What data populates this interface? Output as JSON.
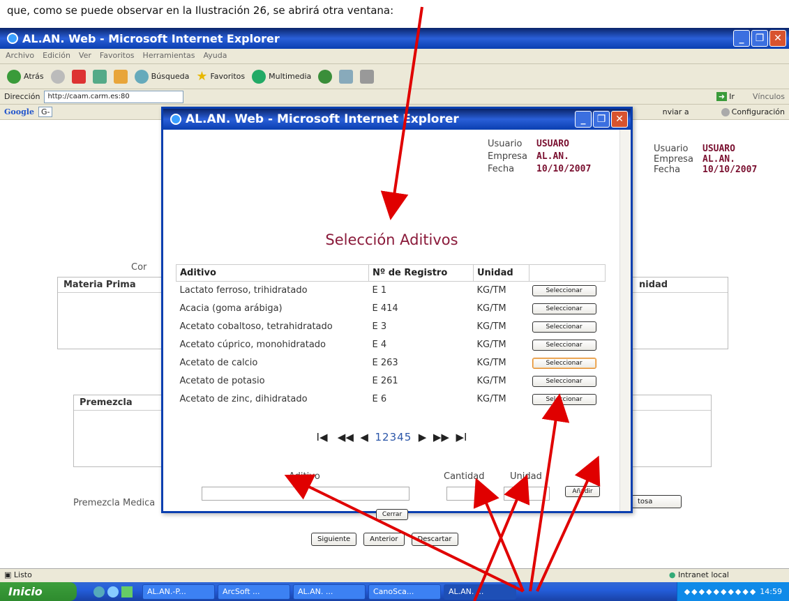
{
  "doc_strip": "que, como se puede observar en la Ilustración 26, se abrirá otra ventana:",
  "main_window": {
    "title": "AL.AN. Web - Microsoft Internet Explorer",
    "menu": [
      "Archivo",
      "Edición",
      "Ver",
      "Favoritos",
      "Herramientas",
      "Ayuda"
    ],
    "toolbar": {
      "back": "Atrás",
      "search": "Búsqueda",
      "favorites": "Favoritos",
      "multimedia": "Multimedia"
    },
    "address_label": "Dirección",
    "address_value": "http://caam.carm.es:80",
    "go_label": "Ir",
    "links_label": "Vínculos",
    "google_label": "Google",
    "google_g": "G-",
    "send_label": "nviar a",
    "config_label": "Configuración"
  },
  "bg_page": {
    "user_label": "Usuario",
    "user_value": "USUARO",
    "company_label": "Empresa",
    "company_value": "AL.AN.",
    "date_label": "Fecha",
    "date_value": "10/10/2007",
    "partial_label": "Cor",
    "materia_prima_header": "Materia Prima",
    "unidad_partial": "nidad",
    "premezcla_header": "Premezcla",
    "premezcla_medica_label": "Premezcla Medica",
    "tosa_button": "tosa",
    "buttons": [
      "Siguiente",
      "Anterior",
      "Descartar"
    ]
  },
  "popup": {
    "title": "AL.AN. Web - Microsoft Internet Explorer",
    "user_label": "Usuario",
    "user_value": "USUARO",
    "company_label": "Empresa",
    "company_value": "AL.AN.",
    "date_label": "Fecha",
    "date_value": "10/10/2007",
    "heading": "Selección Aditivos",
    "columns": [
      "Aditivo",
      "Nº de Registro",
      "Unidad",
      ""
    ],
    "rows": [
      {
        "aditivo": "Lactato ferroso, trihidratado",
        "registro": "E 1",
        "unidad": "KG/TM",
        "button": "Seleccionar"
      },
      {
        "aditivo": "Acacia (goma arábiga)",
        "registro": "E 414",
        "unidad": "KG/TM",
        "button": "Seleccionar"
      },
      {
        "aditivo": "Acetato cobaltoso, tetrahidratado",
        "registro": "E 3",
        "unidad": "KG/TM",
        "button": "Seleccionar"
      },
      {
        "aditivo": "Acetato cúprico, monohidratado",
        "registro": "E 4",
        "unidad": "KG/TM",
        "button": "Seleccionar"
      },
      {
        "aditivo": "Acetato de calcio",
        "registro": "E 263",
        "unidad": "KG/TM",
        "button": "Seleccionar"
      },
      {
        "aditivo": "Acetato de potasio",
        "registro": "E 261",
        "unidad": "KG/TM",
        "button": "Seleccionar"
      },
      {
        "aditivo": "Acetato de zinc, dihidratado",
        "registro": "E 6",
        "unidad": "KG/TM",
        "button": "Seleccionar"
      }
    ],
    "pager": {
      "first": "I◀",
      "prev_block": "◀◀",
      "prev": "◀",
      "pages": "12345",
      "next": "▶",
      "next_block": "▶▶",
      "last": "▶I"
    },
    "form": {
      "aditivo_label": "Aditivo",
      "cantidad_label": "Cantidad",
      "unidad_label": "Unidad",
      "add_button": "Añadir",
      "close_button": "Cerrar"
    }
  },
  "status": {
    "left": "Listo",
    "right": "Intranet local"
  },
  "taskbar": {
    "start": "Inicio",
    "tasks": [
      "AL.AN.-P...",
      "ArcSoft ...",
      "AL.AN. ...",
      "CanoSca...",
      "AL.AN. ..."
    ],
    "clock": "14:59"
  },
  "colors": {
    "accent_red": "#e00000",
    "value_maroon": "#7a1030",
    "xp_blue": "#0a3fb0"
  }
}
